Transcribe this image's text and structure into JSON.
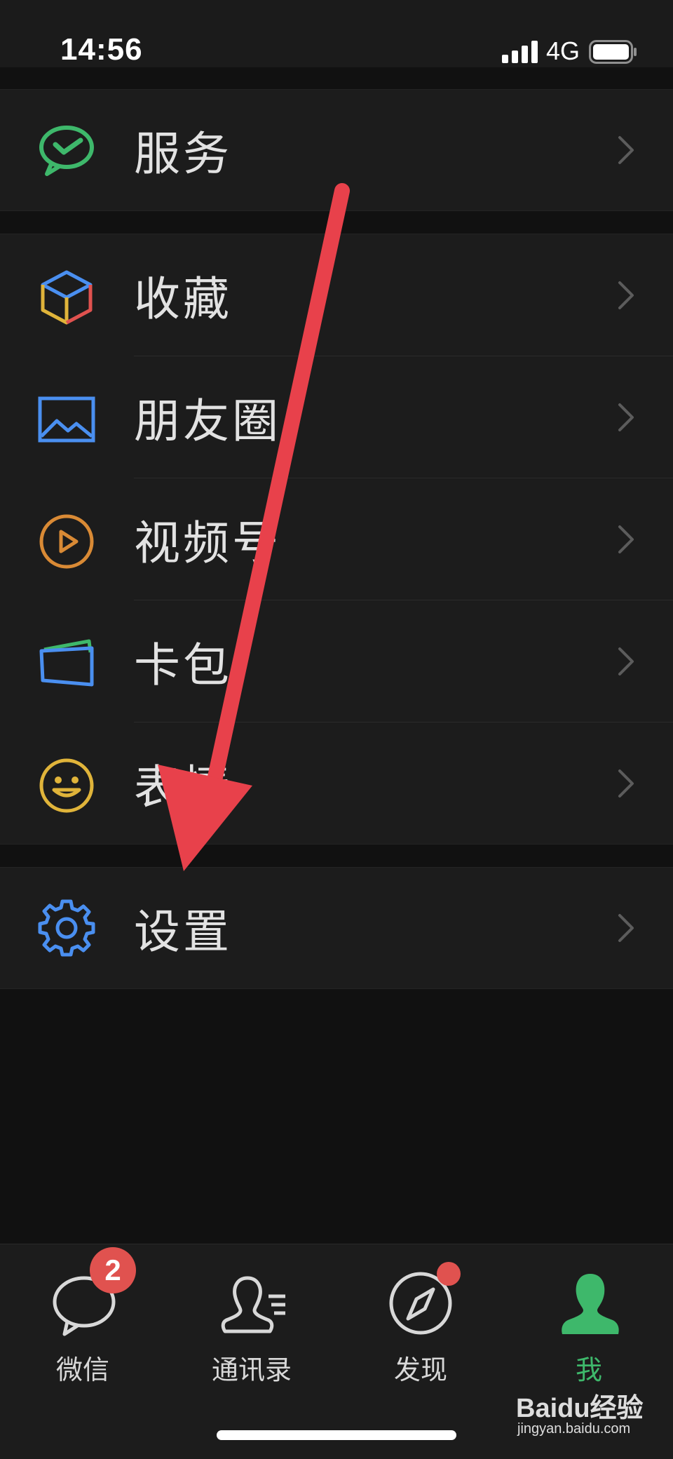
{
  "status_bar": {
    "time": "14:56",
    "network": "4G"
  },
  "menu": {
    "services": {
      "label": "服务",
      "icon": "wechat-pay-icon"
    },
    "favorites": {
      "label": "收藏",
      "icon": "cube-icon"
    },
    "moments": {
      "label": "朋友圈",
      "icon": "image-icon"
    },
    "channels": {
      "label": "视频号",
      "icon": "play-icon"
    },
    "card_wallet": {
      "label": "卡包",
      "icon": "card-icon"
    },
    "stickers": {
      "label": "表情",
      "icon": "smiley-icon"
    },
    "settings": {
      "label": "设置",
      "icon": "gear-icon"
    }
  },
  "tabbar": {
    "chats": {
      "label": "微信",
      "badge": "2"
    },
    "contacts": {
      "label": "通讯录"
    },
    "discover": {
      "label": "发现"
    },
    "me": {
      "label": "我"
    }
  },
  "colors": {
    "accent_green": "#3eb86b",
    "badge_red": "#e0524f",
    "arrow_red": "#e8414b"
  },
  "watermark": {
    "logo": "Baidu经验",
    "url": "jingyan.baidu.com"
  }
}
